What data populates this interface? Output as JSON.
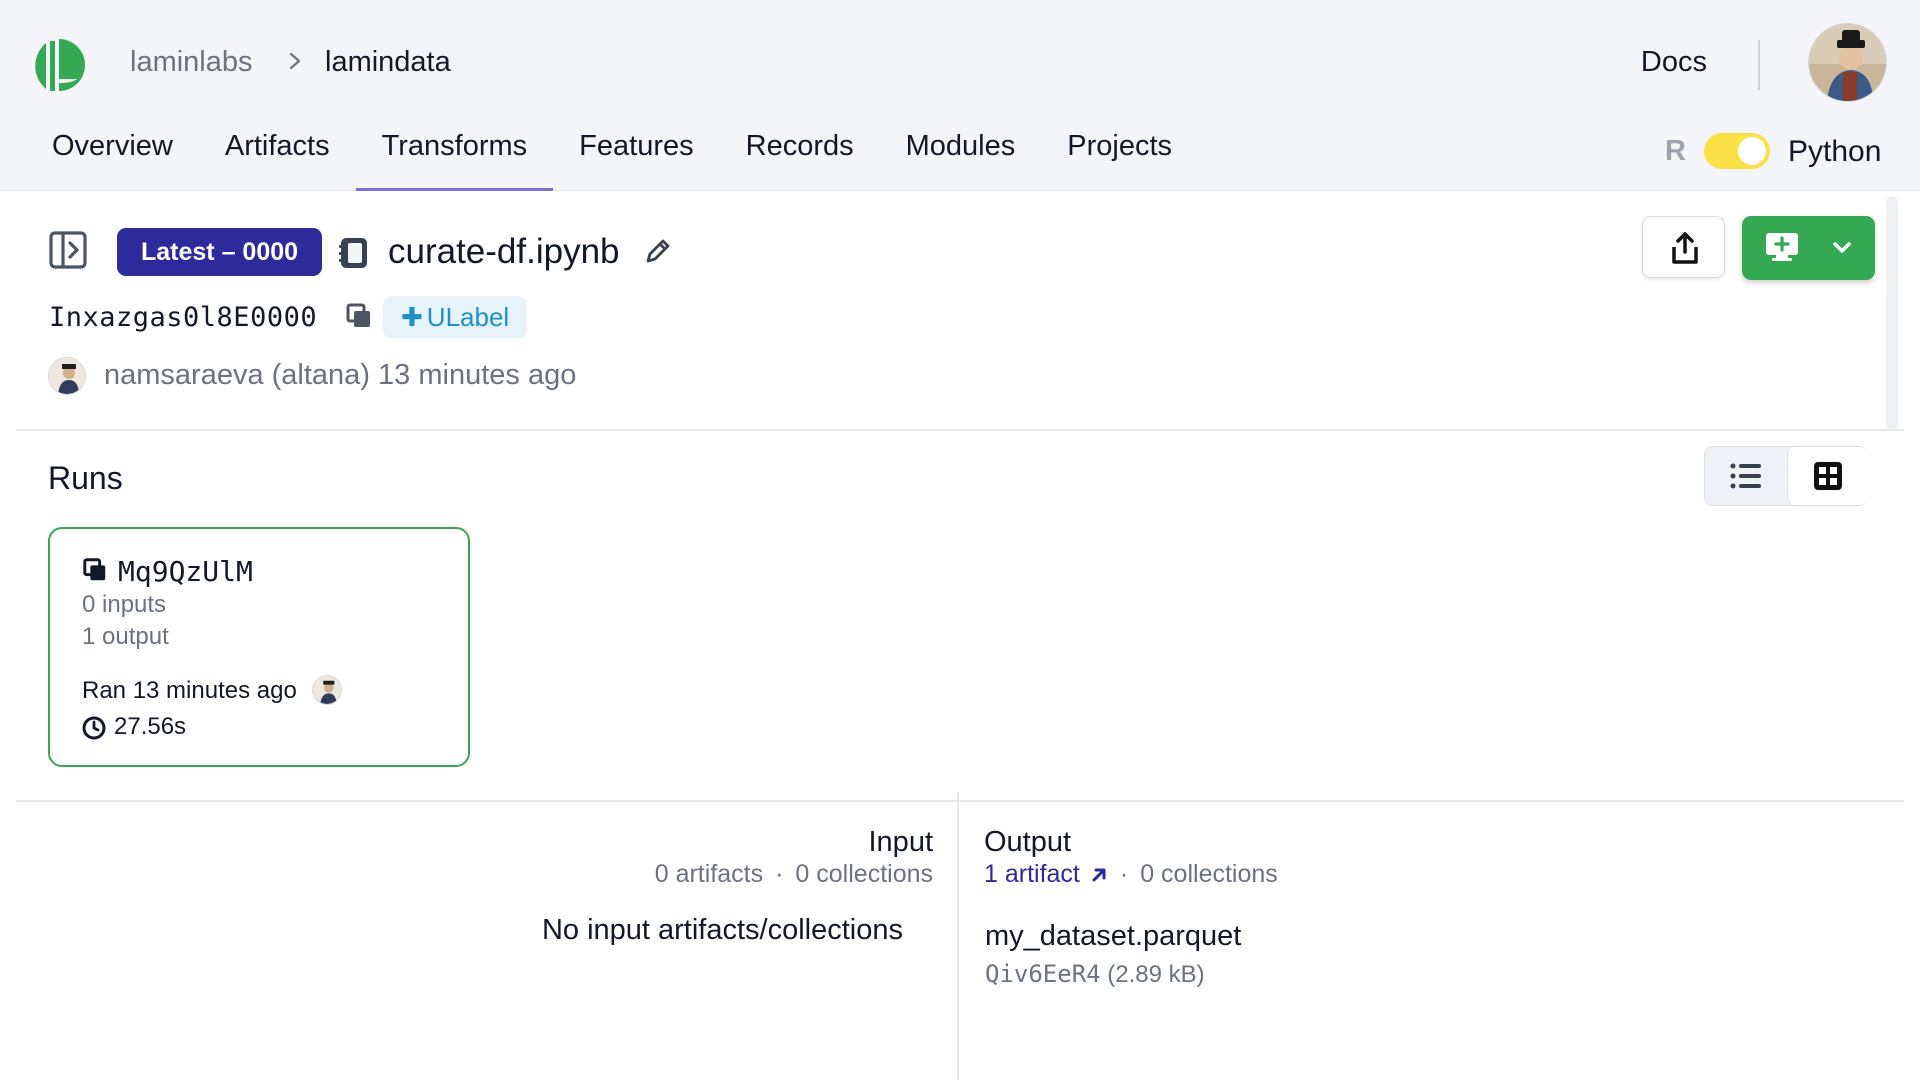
{
  "header": {
    "org": "laminlabs",
    "instance": "lamindata",
    "docs_label": "Docs",
    "nav": [
      "Overview",
      "Artifacts",
      "Transforms",
      "Features",
      "Records",
      "Modules",
      "Projects"
    ],
    "active_tab": "Transforms",
    "lang_left": "R",
    "lang_right": "Python",
    "lang_toggle_on": true,
    "accent_color": "#7c6fd8",
    "toggle_color": "#fde047"
  },
  "transform": {
    "version_badge": "Latest – 0000",
    "title": "curate-df.ipynb",
    "uid": "Inxazgas0l8E0000",
    "ulabel_button": "ULabel",
    "created_by": "namsaraeva (altana) 13 minutes ago",
    "badge_color": "#2d2a9c",
    "load_button_color": "#34a853"
  },
  "runs": {
    "heading": "Runs",
    "view_modes": [
      "list",
      "grid"
    ],
    "active_view": "grid",
    "items": [
      {
        "uid": "Mq9QzUlM",
        "inputs": "0 inputs",
        "outputs": "1 output",
        "ran": "Ran 13 minutes ago",
        "duration": "27.56s"
      }
    ]
  },
  "io": {
    "input": {
      "heading": "Input",
      "artifacts": "0 artifacts",
      "collections": "0 collections",
      "empty_text": "No input artifacts/collections"
    },
    "output": {
      "heading": "Output",
      "artifacts": "1 artifact",
      "collections": "0 collections",
      "items": [
        {
          "name": "my_dataset.parquet",
          "uid": "Qiv6EeR4",
          "size": "(2.89 kB)"
        }
      ]
    },
    "separator": "·"
  },
  "icons": {
    "logo": "lamin-logo",
    "breadcrumb": "chevron-right-icon",
    "sidebar": "sidebar-toggle-icon",
    "notebook": "notebook-icon",
    "edit": "pencil-icon",
    "copy": "copy-icon",
    "share": "share-icon",
    "load": "monitor-plus-icon",
    "list": "list-icon",
    "grid": "grid-icon",
    "clock": "clock-icon",
    "external": "arrow-up-right-icon"
  }
}
